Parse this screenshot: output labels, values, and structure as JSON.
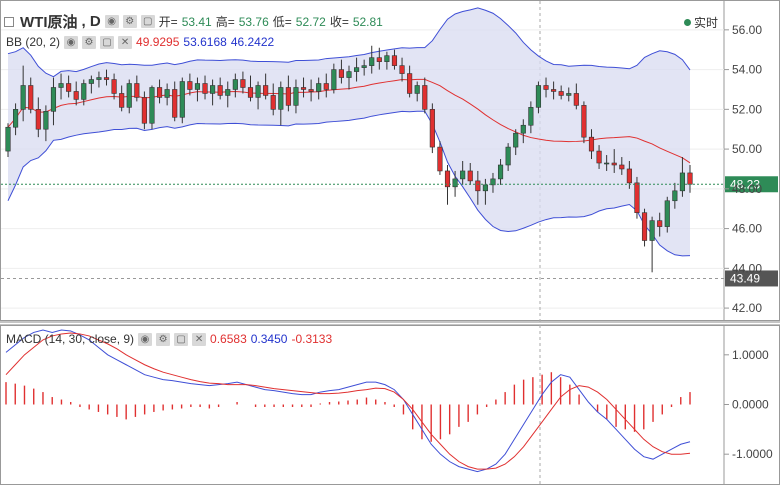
{
  "header": {
    "symbol": "WTI原油",
    "timeframe": ", D",
    "open_label": "开=",
    "open_value": "53.41",
    "high_label": "高=",
    "high_value": "53.76",
    "low_label": "低=",
    "low_value": "52.72",
    "close_label": "收=",
    "close_value": "52.81",
    "realtime_label": "实时"
  },
  "bb_header": {
    "label": "BB (20, 2)",
    "basis": "49.9295",
    "upper": "53.6168",
    "lower": "46.2422"
  },
  "macd_header": {
    "label": "MACD (14, 30, close, 9)",
    "macd": "0.6583",
    "signal": "0.3450",
    "histogram": "-0.3133"
  },
  "colors": {
    "up_candle": "#2e8b57",
    "down_candle": "#e03030",
    "band_fill": "#d8dbf0",
    "band_line": "#3f4fd6",
    "basis_line": "#e03030",
    "macd_line": "#3f4fd6",
    "signal_line": "#e03030",
    "histogram": "#e03030",
    "last_price_badge": "#2e8b57",
    "support_badge": "#555555"
  },
  "chart_data": [
    {
      "type": "candlestick",
      "title": "WTI原油, D",
      "price_axis": {
        "ticks": [
          42.0,
          44.0,
          46.0,
          48.0,
          50.0,
          52.0,
          54.0,
          56.0
        ],
        "ylim": [
          41.4,
          57.2
        ]
      },
      "last_price": 48.23,
      "support_level": 43.49,
      "candles": [
        [
          49.9,
          51.3,
          49.6,
          51.1
        ],
        [
          51.1,
          52.3,
          50.7,
          52.0
        ],
        [
          52.0,
          54.2,
          51.4,
          53.2
        ],
        [
          53.2,
          53.6,
          51.8,
          52.0
        ],
        [
          52.0,
          52.6,
          50.6,
          51.0
        ],
        [
          51.0,
          52.2,
          50.4,
          51.9
        ],
        [
          51.9,
          53.6,
          51.2,
          53.1
        ],
        [
          53.1,
          53.8,
          52.5,
          53.3
        ],
        [
          53.3,
          53.7,
          52.6,
          52.9
        ],
        [
          52.9,
          53.4,
          52.2,
          52.5
        ],
        [
          52.5,
          53.5,
          52.2,
          53.3
        ],
        [
          53.3,
          53.7,
          52.8,
          53.5
        ],
        [
          53.5,
          53.9,
          53.1,
          53.6
        ],
        [
          53.6,
          54.0,
          53.2,
          53.5
        ],
        [
          53.5,
          53.8,
          52.5,
          52.8
        ],
        [
          52.8,
          53.2,
          51.9,
          52.1
        ],
        [
          52.1,
          53.5,
          51.8,
          53.3
        ],
        [
          53.3,
          53.7,
          52.4,
          52.6
        ],
        [
          52.6,
          52.9,
          51.0,
          51.3
        ],
        [
          51.3,
          53.2,
          51.0,
          53.1
        ],
        [
          53.1,
          53.5,
          52.3,
          52.6
        ],
        [
          52.6,
          53.3,
          52.2,
          53.0
        ],
        [
          53.0,
          53.4,
          51.4,
          51.6
        ],
        [
          51.6,
          53.6,
          51.3,
          53.4
        ],
        [
          53.4,
          53.8,
          52.7,
          53.0
        ],
        [
          53.0,
          53.6,
          52.4,
          53.3
        ],
        [
          53.3,
          53.7,
          52.5,
          52.8
        ],
        [
          52.8,
          53.5,
          52.2,
          53.2
        ],
        [
          53.2,
          53.6,
          52.5,
          52.7
        ],
        [
          52.7,
          53.4,
          52.1,
          53.0
        ],
        [
          53.0,
          53.8,
          52.6,
          53.5
        ],
        [
          53.5,
          53.9,
          52.8,
          53.1
        ],
        [
          53.1,
          53.7,
          52.4,
          52.6
        ],
        [
          52.6,
          53.4,
          52.0,
          53.2
        ],
        [
          53.2,
          53.8,
          52.5,
          52.7
        ],
        [
          52.7,
          53.3,
          51.7,
          52.0
        ],
        [
          52.0,
          53.4,
          51.2,
          53.1
        ],
        [
          53.1,
          53.7,
          51.9,
          52.2
        ],
        [
          52.2,
          53.5,
          51.8,
          53.1
        ],
        [
          53.1,
          53.6,
          52.6,
          53.0
        ],
        [
          53.0,
          53.5,
          52.4,
          52.9
        ],
        [
          52.9,
          53.6,
          52.5,
          53.3
        ],
        [
          53.3,
          53.8,
          52.6,
          53.0
        ],
        [
          53.0,
          54.3,
          52.8,
          54.0
        ],
        [
          54.0,
          54.5,
          53.3,
          53.6
        ],
        [
          53.6,
          54.2,
          53.0,
          53.9
        ],
        [
          53.9,
          54.6,
          53.4,
          54.1
        ],
        [
          54.1,
          54.5,
          53.7,
          54.2
        ],
        [
          54.2,
          55.2,
          53.8,
          54.6
        ],
        [
          54.6,
          55.1,
          54.0,
          54.4
        ],
        [
          54.4,
          54.9,
          54.0,
          54.7
        ],
        [
          54.7,
          55.0,
          54.0,
          54.2
        ],
        [
          54.2,
          54.6,
          53.4,
          53.8
        ],
        [
          53.8,
          54.2,
          52.6,
          52.8
        ],
        [
          52.8,
          53.4,
          52.4,
          53.2
        ],
        [
          53.2,
          53.6,
          51.8,
          52.0
        ],
        [
          52.0,
          52.3,
          49.8,
          50.1
        ],
        [
          50.1,
          50.4,
          48.7,
          48.9
        ],
        [
          48.9,
          49.2,
          47.2,
          48.1
        ],
        [
          48.1,
          48.9,
          47.6,
          48.5
        ],
        [
          48.5,
          49.4,
          48.2,
          48.9
        ],
        [
          48.9,
          49.3,
          48.2,
          48.4
        ],
        [
          48.4,
          48.9,
          47.2,
          47.9
        ],
        [
          47.9,
          48.5,
          47.2,
          48.2
        ],
        [
          48.2,
          48.8,
          47.8,
          48.5
        ],
        [
          48.5,
          49.5,
          48.2,
          49.2
        ],
        [
          49.2,
          50.3,
          48.9,
          50.1
        ],
        [
          50.1,
          51.0,
          49.7,
          50.8
        ],
        [
          50.8,
          51.5,
          50.3,
          51.2
        ],
        [
          51.2,
          52.4,
          50.8,
          52.1
        ],
        [
          52.1,
          53.4,
          51.8,
          53.2
        ],
        [
          53.2,
          53.6,
          52.6,
          53.0
        ],
        [
          53.0,
          53.4,
          52.5,
          52.9
        ],
        [
          52.9,
          53.2,
          52.5,
          52.7
        ],
        [
          52.7,
          53.1,
          52.4,
          52.8
        ],
        [
          52.8,
          53.3,
          52.0,
          52.2
        ],
        [
          52.2,
          52.4,
          50.3,
          50.6
        ],
        [
          50.6,
          51.0,
          49.5,
          49.9
        ],
        [
          49.9,
          50.2,
          49.0,
          49.3
        ],
        [
          49.3,
          49.7,
          48.9,
          49.3
        ],
        [
          49.3,
          50.0,
          48.8,
          49.2
        ],
        [
          49.2,
          49.6,
          48.7,
          49.0
        ],
        [
          49.0,
          49.4,
          48.0,
          48.3
        ],
        [
          48.3,
          48.6,
          46.5,
          46.8
        ],
        [
          46.8,
          47.0,
          45.1,
          45.4
        ],
        [
          45.4,
          46.6,
          43.8,
          46.4
        ],
        [
          46.4,
          46.8,
          45.6,
          46.1
        ],
        [
          46.1,
          47.6,
          45.8,
          47.4
        ],
        [
          47.4,
          48.3,
          47.0,
          47.9
        ],
        [
          47.9,
          49.6,
          47.6,
          48.8
        ],
        [
          48.8,
          49.2,
          47.8,
          48.23
        ]
      ]
    },
    {
      "type": "line",
      "title": "MACD (14, 30, close, 9)",
      "ylim": [
        -1.6,
        1.6
      ],
      "y_ticks": [
        "1.0000",
        "0.0000",
        "-1.0000"
      ],
      "y_tick_values": [
        1.0,
        0.0,
        -1.0
      ],
      "series": [
        {
          "name": "MACD",
          "values": [
            1.05,
            1.2,
            1.35,
            1.45,
            1.5,
            1.45,
            1.5,
            1.48,
            1.4,
            1.3,
            1.15,
            1.0,
            0.9,
            0.8,
            0.7,
            0.6,
            0.55,
            0.5,
            0.48,
            0.45,
            0.42,
            0.4,
            0.38,
            0.4,
            0.42,
            0.45,
            0.4,
            0.35,
            0.3,
            0.28,
            0.25,
            0.22,
            0.2,
            0.2,
            0.25,
            0.28,
            0.3,
            0.35,
            0.4,
            0.45,
            0.45,
            0.4,
            0.3,
            0.1,
            -0.2,
            -0.5,
            -0.8,
            -1.0,
            -1.15,
            -1.25,
            -1.3,
            -1.35,
            -1.3,
            -1.2,
            -1.0,
            -0.7,
            -0.4,
            -0.1,
            0.2,
            0.45,
            0.6,
            0.55,
            0.3,
            0.05,
            -0.15,
            -0.3,
            -0.5,
            -0.7,
            -0.9,
            -1.05,
            -1.1,
            -1.0,
            -0.9,
            -0.8,
            -0.75
          ]
        },
        {
          "name": "Signal",
          "values": [
            0.6,
            0.8,
            1.0,
            1.15,
            1.3,
            1.38,
            1.42,
            1.44,
            1.42,
            1.38,
            1.3,
            1.22,
            1.12,
            1.0,
            0.9,
            0.8,
            0.72,
            0.65,
            0.6,
            0.55,
            0.5,
            0.46,
            0.43,
            0.42,
            0.4,
            0.4,
            0.4,
            0.38,
            0.35,
            0.32,
            0.3,
            0.28,
            0.26,
            0.24,
            0.22,
            0.22,
            0.23,
            0.25,
            0.28,
            0.3,
            0.33,
            0.32,
            0.25,
            0.1,
            -0.1,
            -0.35,
            -0.6,
            -0.8,
            -1.0,
            -1.15,
            -1.25,
            -1.3,
            -1.3,
            -1.28,
            -1.2,
            -1.05,
            -0.85,
            -0.6,
            -0.35,
            -0.1,
            0.15,
            0.3,
            0.38,
            0.35,
            0.25,
            0.1,
            -0.1,
            -0.3,
            -0.5,
            -0.7,
            -0.85,
            -0.95,
            -1.0,
            -1.0,
            -0.98
          ]
        }
      ],
      "histogram": [
        0.45,
        0.42,
        0.38,
        0.32,
        0.25,
        0.15,
        0.1,
        0.05,
        -0.05,
        -0.1,
        -0.15,
        -0.2,
        -0.25,
        -0.3,
        -0.25,
        -0.2,
        -0.15,
        -0.12,
        -0.1,
        -0.08,
        -0.05,
        -0.05,
        -0.08,
        -0.05,
        0.0,
        0.05,
        0.0,
        -0.05,
        -0.05,
        -0.05,
        -0.05,
        -0.05,
        -0.05,
        -0.05,
        0.02,
        0.05,
        0.06,
        0.08,
        0.1,
        0.14,
        0.1,
        0.05,
        -0.05,
        -0.2,
        -0.5,
        -0.7,
        -0.75,
        -0.7,
        -0.6,
        -0.45,
        -0.35,
        -0.2,
        -0.05,
        0.1,
        0.25,
        0.4,
        0.5,
        0.55,
        0.6,
        0.65,
        0.55,
        0.4,
        0.2,
        0.0,
        -0.15,
        -0.3,
        -0.45,
        -0.5,
        -0.55,
        -0.5,
        -0.35,
        -0.2,
        -0.05,
        0.15,
        0.25
      ]
    }
  ]
}
